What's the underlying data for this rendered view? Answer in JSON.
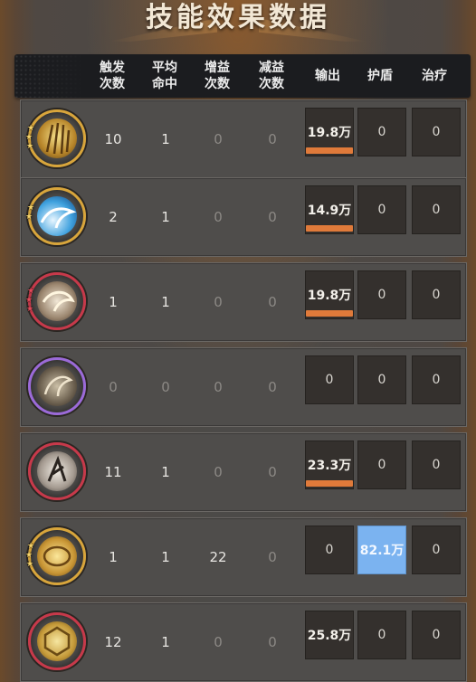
{
  "title": "技能效果数据",
  "headers": {
    "trigger": [
      "触发",
      "次数"
    ],
    "avg_hit": [
      "平均",
      "命中"
    ],
    "buff": [
      "增益",
      "次数"
    ],
    "debuff": [
      "减益",
      "次数"
    ],
    "output": "输出",
    "shield": "护盾",
    "heal": "治疗"
  },
  "colors": {
    "output_bar": "#e07a3a",
    "shield_highlight": "#7bb3f0",
    "gold_ring": "#d8a53b",
    "red_ring": "#c7394a"
  },
  "rows": [
    {
      "icon": "golden-claws-skill-icon",
      "stars": 3,
      "trigger": "10",
      "avg_hit": "1",
      "buff": "0",
      "debuff": "0",
      "output": "19.8万",
      "shield": "0",
      "heal": "0",
      "output_bar": 1.0
    },
    {
      "icon": "water-wave-skill-icon",
      "stars": 2,
      "trigger": "2",
      "avg_hit": "1",
      "buff": "0",
      "debuff": "0",
      "output": "14.9万",
      "shield": "0",
      "heal": "0",
      "output_bar": 1.0
    },
    {
      "icon": "white-dragon-skill-icon",
      "stars": 3,
      "trigger": "1",
      "avg_hit": "1",
      "buff": "0",
      "debuff": "0",
      "output": "19.8万",
      "shield": "0",
      "heal": "0",
      "output_bar": 1.0
    },
    {
      "icon": "bone-dragon-skill-icon",
      "stars": 0,
      "trigger": "0",
      "avg_hit": "0",
      "buff": "0",
      "debuff": "0",
      "output": "0",
      "shield": "0",
      "heal": "0",
      "output_bar": 0
    },
    {
      "icon": "spiral-claw-skill-icon",
      "stars": 0,
      "trigger": "11",
      "avg_hit": "1",
      "buff": "0",
      "debuff": "0",
      "output": "23.3万",
      "shield": "0",
      "heal": "0",
      "output_bar": 1.0
    },
    {
      "icon": "golden-shield-skill-icon",
      "stars": 3,
      "trigger": "1",
      "avg_hit": "1",
      "buff": "22",
      "debuff": "0",
      "output": "0",
      "shield": "82.1万",
      "heal": "0",
      "output_bar": 0
    },
    {
      "icon": "hexagon-emblem-skill-icon",
      "stars": 0,
      "trigger": "12",
      "avg_hit": "1",
      "buff": "0",
      "debuff": "0",
      "output": "25.8万",
      "shield": "0",
      "heal": "0",
      "output_bar": 1.0
    }
  ]
}
